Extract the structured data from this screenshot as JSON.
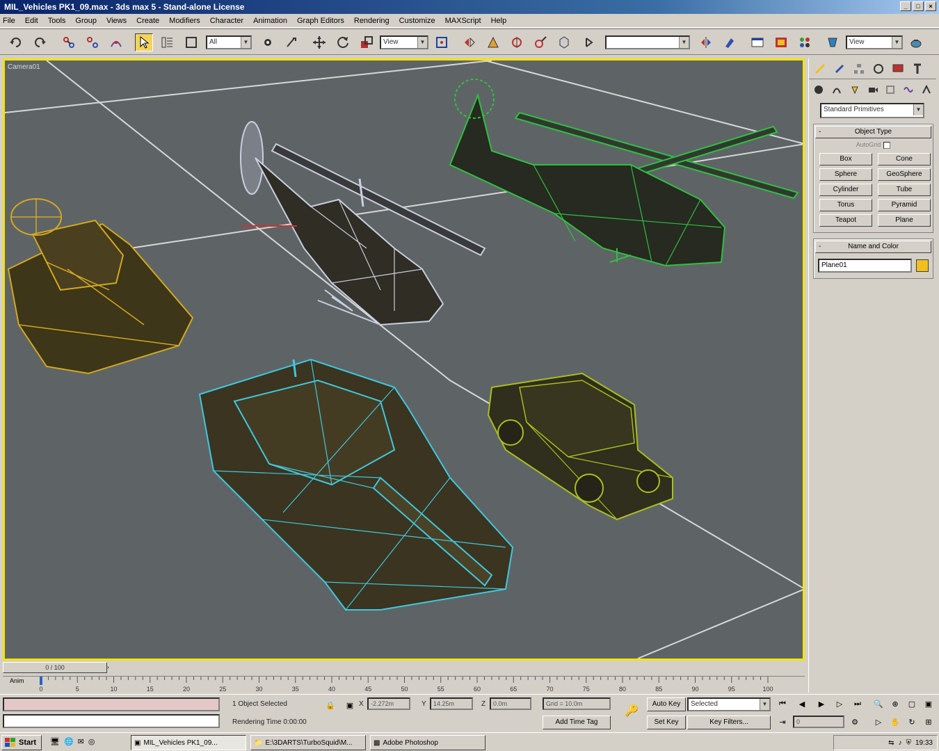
{
  "window": {
    "title": "MIL_Vehicles PK1_09.max - 3ds max 5 - Stand-alone License",
    "min": "_",
    "max": "□",
    "close": "×"
  },
  "menu": [
    "File",
    "Edit",
    "Tools",
    "Group",
    "Views",
    "Create",
    "Modifiers",
    "Character",
    "Animation",
    "Graph Editors",
    "Rendering",
    "Customize",
    "MAXScript",
    "Help"
  ],
  "toolbar": {
    "selection_filter": "All",
    "ref_coord": "View",
    "named_selection": "",
    "view_combo": "View"
  },
  "viewport": {
    "label": "Camera01",
    "frame_color": "#f5e400",
    "background": "#5e6466"
  },
  "command_panel": {
    "category": "Standard Primitives",
    "object_type_title": "Object Type",
    "autogrid": "AutoGrid",
    "buttons": [
      "Box",
      "Cone",
      "Sphere",
      "GeoSphere",
      "Cylinder",
      "Tube",
      "Torus",
      "Pyramid",
      "Teapot",
      "Plane"
    ],
    "name_color_title": "Name and Color",
    "object_name": "Plane01",
    "object_color": "#f0c020"
  },
  "timeline": {
    "slider_label": "0 / 100",
    "ticks": [
      "0",
      "5",
      "10",
      "15",
      "20",
      "25",
      "30",
      "35",
      "40",
      "45",
      "50",
      "55",
      "60",
      "65",
      "70",
      "75",
      "80",
      "85",
      "90",
      "95",
      "100"
    ],
    "anim_label": "Anim"
  },
  "status": {
    "selected": "1 Object Selected",
    "render_time": "Rendering Time  0:00:00",
    "x_label": "X",
    "x_value": "-2.272m",
    "y_label": "Y",
    "y_value": "14.25m",
    "z_label": "Z",
    "z_value": "0.0m",
    "grid": "Grid = 10.0m",
    "add_time_tag": "Add Time Tag",
    "auto_key": "Auto Key",
    "set_key": "Set Key",
    "key_mode": "Selected",
    "key_filters": "Key Filters...",
    "frame": "0"
  },
  "taskbar": {
    "start": "Start",
    "tasks": [
      "MIL_Vehicles PK1_09...",
      "E:\\3DARTS\\TurboSquid\\M...",
      "Adobe Photoshop"
    ],
    "clock": "19:33"
  }
}
